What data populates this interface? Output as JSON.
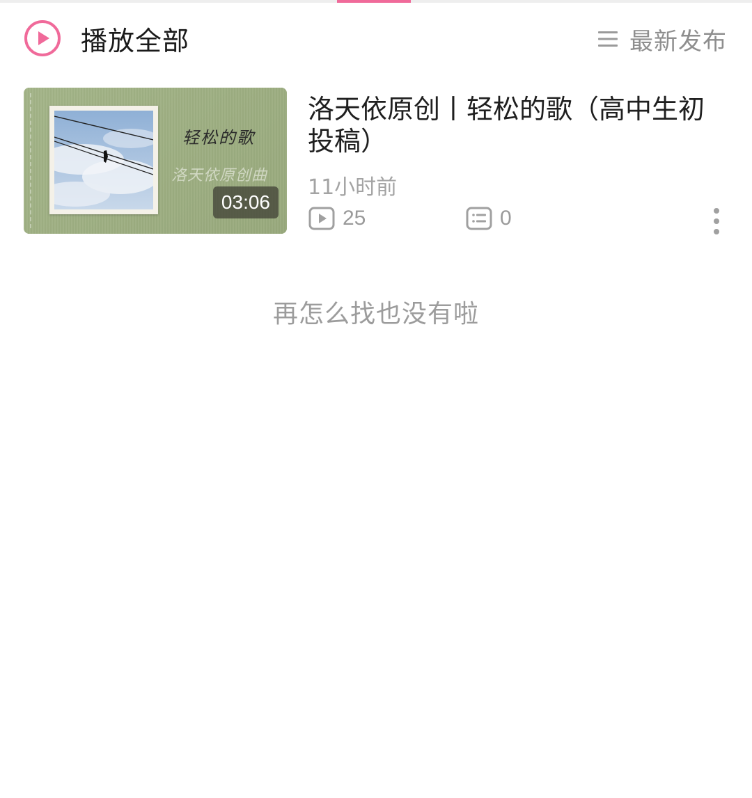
{
  "header": {
    "play_all_label": "播放全部",
    "play_all_icon": "play-circle-icon",
    "sort_label": "最新发布",
    "sort_icon": "sort-lines-icon"
  },
  "videos": [
    {
      "title": "洛天依原创丨轻松的歌（高中生初投稿）",
      "duration": "03:06",
      "thumbnail_text_title": "轻松的歌",
      "thumbnail_text_sub": "洛天依原创曲",
      "time_ago": "11小时前",
      "plays": "25",
      "comments": "0",
      "plays_icon": "play-count-icon",
      "comments_icon": "comment-icon",
      "more_icon": "more-vertical-icon"
    }
  ],
  "footer": {
    "end_text": "再怎么找也没有啦"
  },
  "colors": {
    "accent": "#f06a9a",
    "muted_text": "#9a9a9a",
    "thumbnail_green": "#9fb084"
  }
}
